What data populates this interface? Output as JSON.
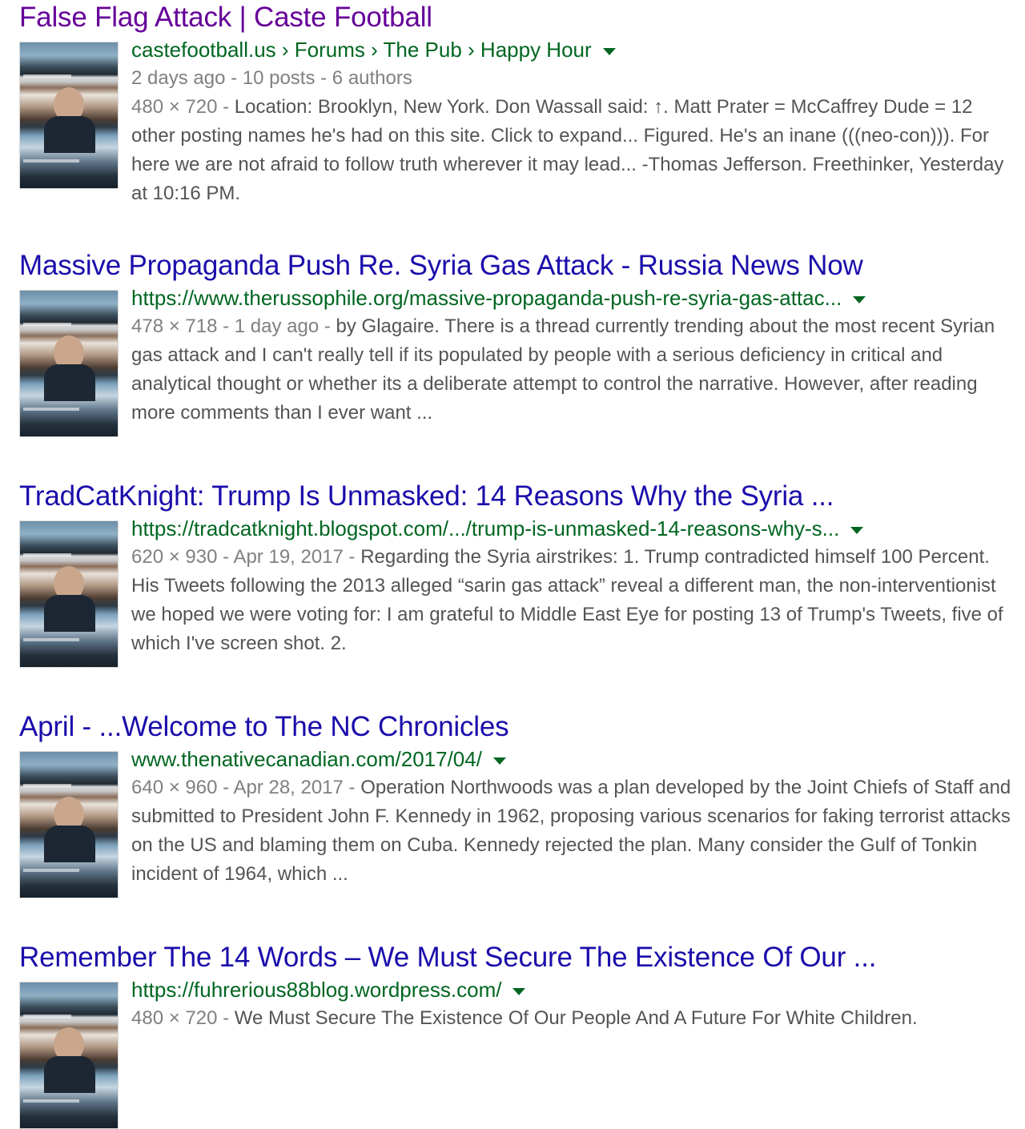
{
  "results": [
    {
      "title": "False Flag Attack | Caste Football",
      "url": "castefootball.us › Forums › The Pub › Happy Hour",
      "meta": "2 days ago - 10 posts - 6 authors",
      "dims": "480 × 720 - ",
      "date": "",
      "snippet": "Location: Brooklyn, New York. Don Wassall said: ↑. Matt Prater = McCaffrey Dude = 12 other posting names he's had on this site. Click to expand... Figured. He's an inane (((neo-con))). For here we are not afraid to follow truth wherever it may lead... -Thomas Jefferson. Freethinker, Yesterday at 10:16 PM."
    },
    {
      "title": "Massive Propaganda Push Re. Syria Gas Attack - Russia News Now",
      "url": "https://www.therussophile.org/massive-propaganda-push-re-syria-gas-attac...",
      "meta": "",
      "dims": "478 × 718 - ",
      "date": "1 day ago - ",
      "snippet": "by Glagaire. There is a thread currently trending about the most recent Syrian gas attack and I can't really tell if its populated by people with a serious deficiency in critical and analytical thought or whether its a deliberate attempt to control the narrative. However, after reading more comments than I ever want ..."
    },
    {
      "title": "TradCatKnight: Trump Is Unmasked: 14 Reasons Why the Syria ...",
      "url": "https://tradcatknight.blogspot.com/.../trump-is-unmasked-14-reasons-why-s...",
      "meta": "",
      "dims": "620 × 930 - ",
      "date": "Apr 19, 2017 - ",
      "snippet": "Regarding the Syria airstrikes: 1. Trump contradicted himself 100 Percent. His Tweets following the 2013 alleged “sarin gas attack” reveal a different man, the non-interventionist we hoped we were voting for: I am grateful to Middle East Eye for posting 13 of Trump's Tweets, five of which I've screen shot. 2."
    },
    {
      "title": "April - ...Welcome to The NC Chronicles",
      "url": "www.thenativecanadian.com/2017/04/",
      "meta": "",
      "dims": "640 × 960 - ",
      "date": "Apr 28, 2017 - ",
      "snippet": "Operation Northwoods was a plan developed by the Joint Chiefs of Staff and submitted to President John F. Kennedy in 1962, proposing various scenarios for faking terrorist attacks on the US and blaming them on Cuba. Kennedy rejected the plan. Many consider the Gulf of Tonkin incident of 1964, which ..."
    },
    {
      "title": "Remember The 14 Words – We Must Secure The Existence Of Our ...",
      "url": "https://fuhrerious88blog.wordpress.com/",
      "meta": "",
      "dims": "480 × 720 - ",
      "date": "",
      "snippet": "We Must Secure The Existence Of Our People And A Future For White Children."
    }
  ]
}
